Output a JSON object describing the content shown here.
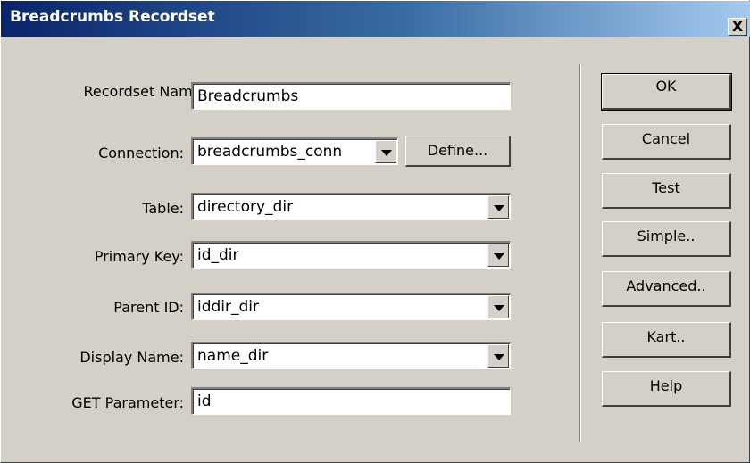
{
  "window": {
    "title": "Breadcrumbs Recordset",
    "close_label": "X"
  },
  "form": {
    "recordset_name": {
      "label": "Recordset Name:",
      "value": "Breadcrumbs"
    },
    "connection": {
      "label": "Connection:",
      "value": "breadcrumbs_conn",
      "define_label": "Define..."
    },
    "table": {
      "label": "Table:",
      "value": "directory_dir"
    },
    "primary_key": {
      "label": "Primary Key:",
      "value": "id_dir"
    },
    "parent_id": {
      "label": "Parent ID:",
      "value": "iddir_dir"
    },
    "display_name": {
      "label": "Display Name:",
      "value": "name_dir"
    },
    "get_parameter": {
      "label": "GET Parameter:",
      "value": "id"
    }
  },
  "buttons": {
    "ok": "OK",
    "cancel": "Cancel",
    "test": "Test",
    "simple": "Simple..",
    "advanced": "Advanced..",
    "kart": "Kart..",
    "help": "Help"
  }
}
